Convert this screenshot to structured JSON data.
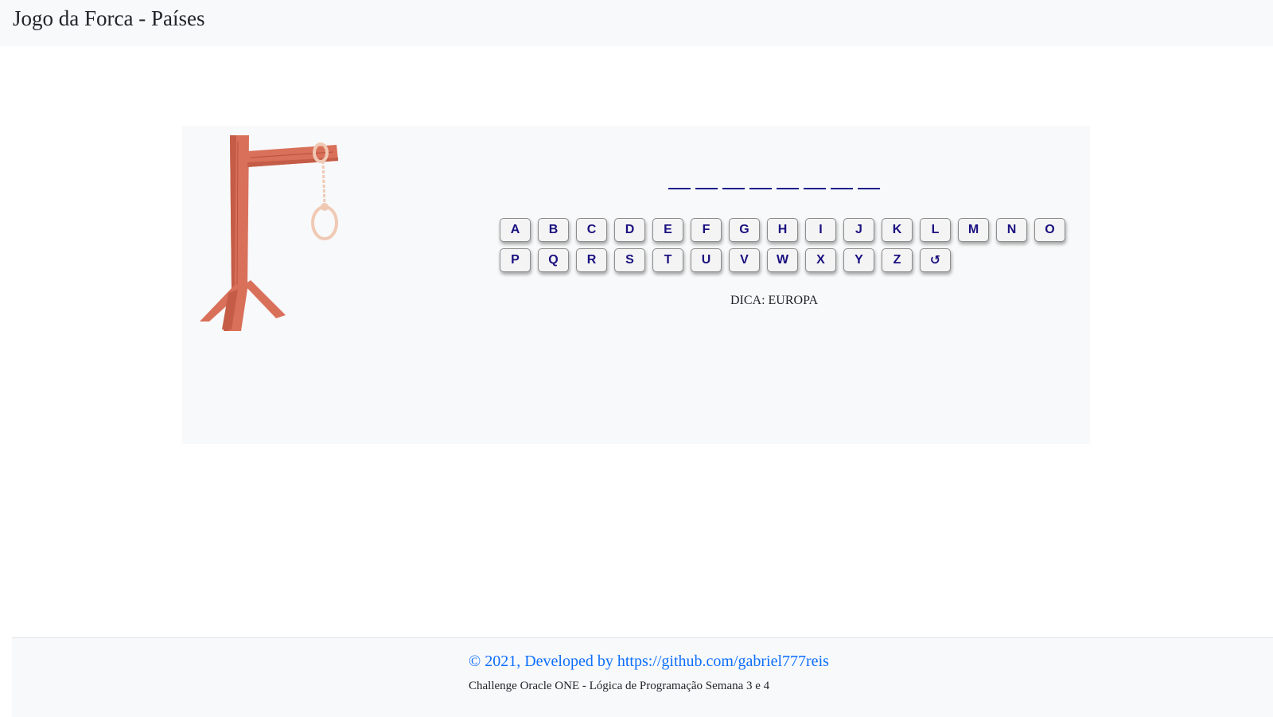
{
  "header": {
    "title": "Jogo da Forca - Países"
  },
  "game": {
    "word_slots": [
      "",
      "",
      "",
      "",
      "",
      "",
      "",
      ""
    ],
    "keyboard_rows": [
      [
        "A",
        "B",
        "C",
        "D",
        "E",
        "F",
        "G",
        "H",
        "I",
        "J",
        "K",
        "L",
        "M",
        "N",
        "O"
      ],
      [
        "P",
        "Q",
        "R",
        "S",
        "T",
        "U",
        "V",
        "W",
        "X",
        "Y",
        "Z"
      ]
    ],
    "reset_label": "↺",
    "hint": "DICA: EUROPA",
    "gallows_icon": "gallows-icon"
  },
  "footer": {
    "copyright_prefix": "© 2021, Developed by ",
    "link_text": "https://github.com/gabriel777reis",
    "subtitle": "Challenge Oracle ONE - Lógica de Programação Semana 3 e 4"
  },
  "colors": {
    "panel_bg": "#f8f9fa",
    "key_text": "#1a1080",
    "link": "#0d6efd",
    "wood": "#d9705a",
    "rope": "#f0c9b4"
  }
}
